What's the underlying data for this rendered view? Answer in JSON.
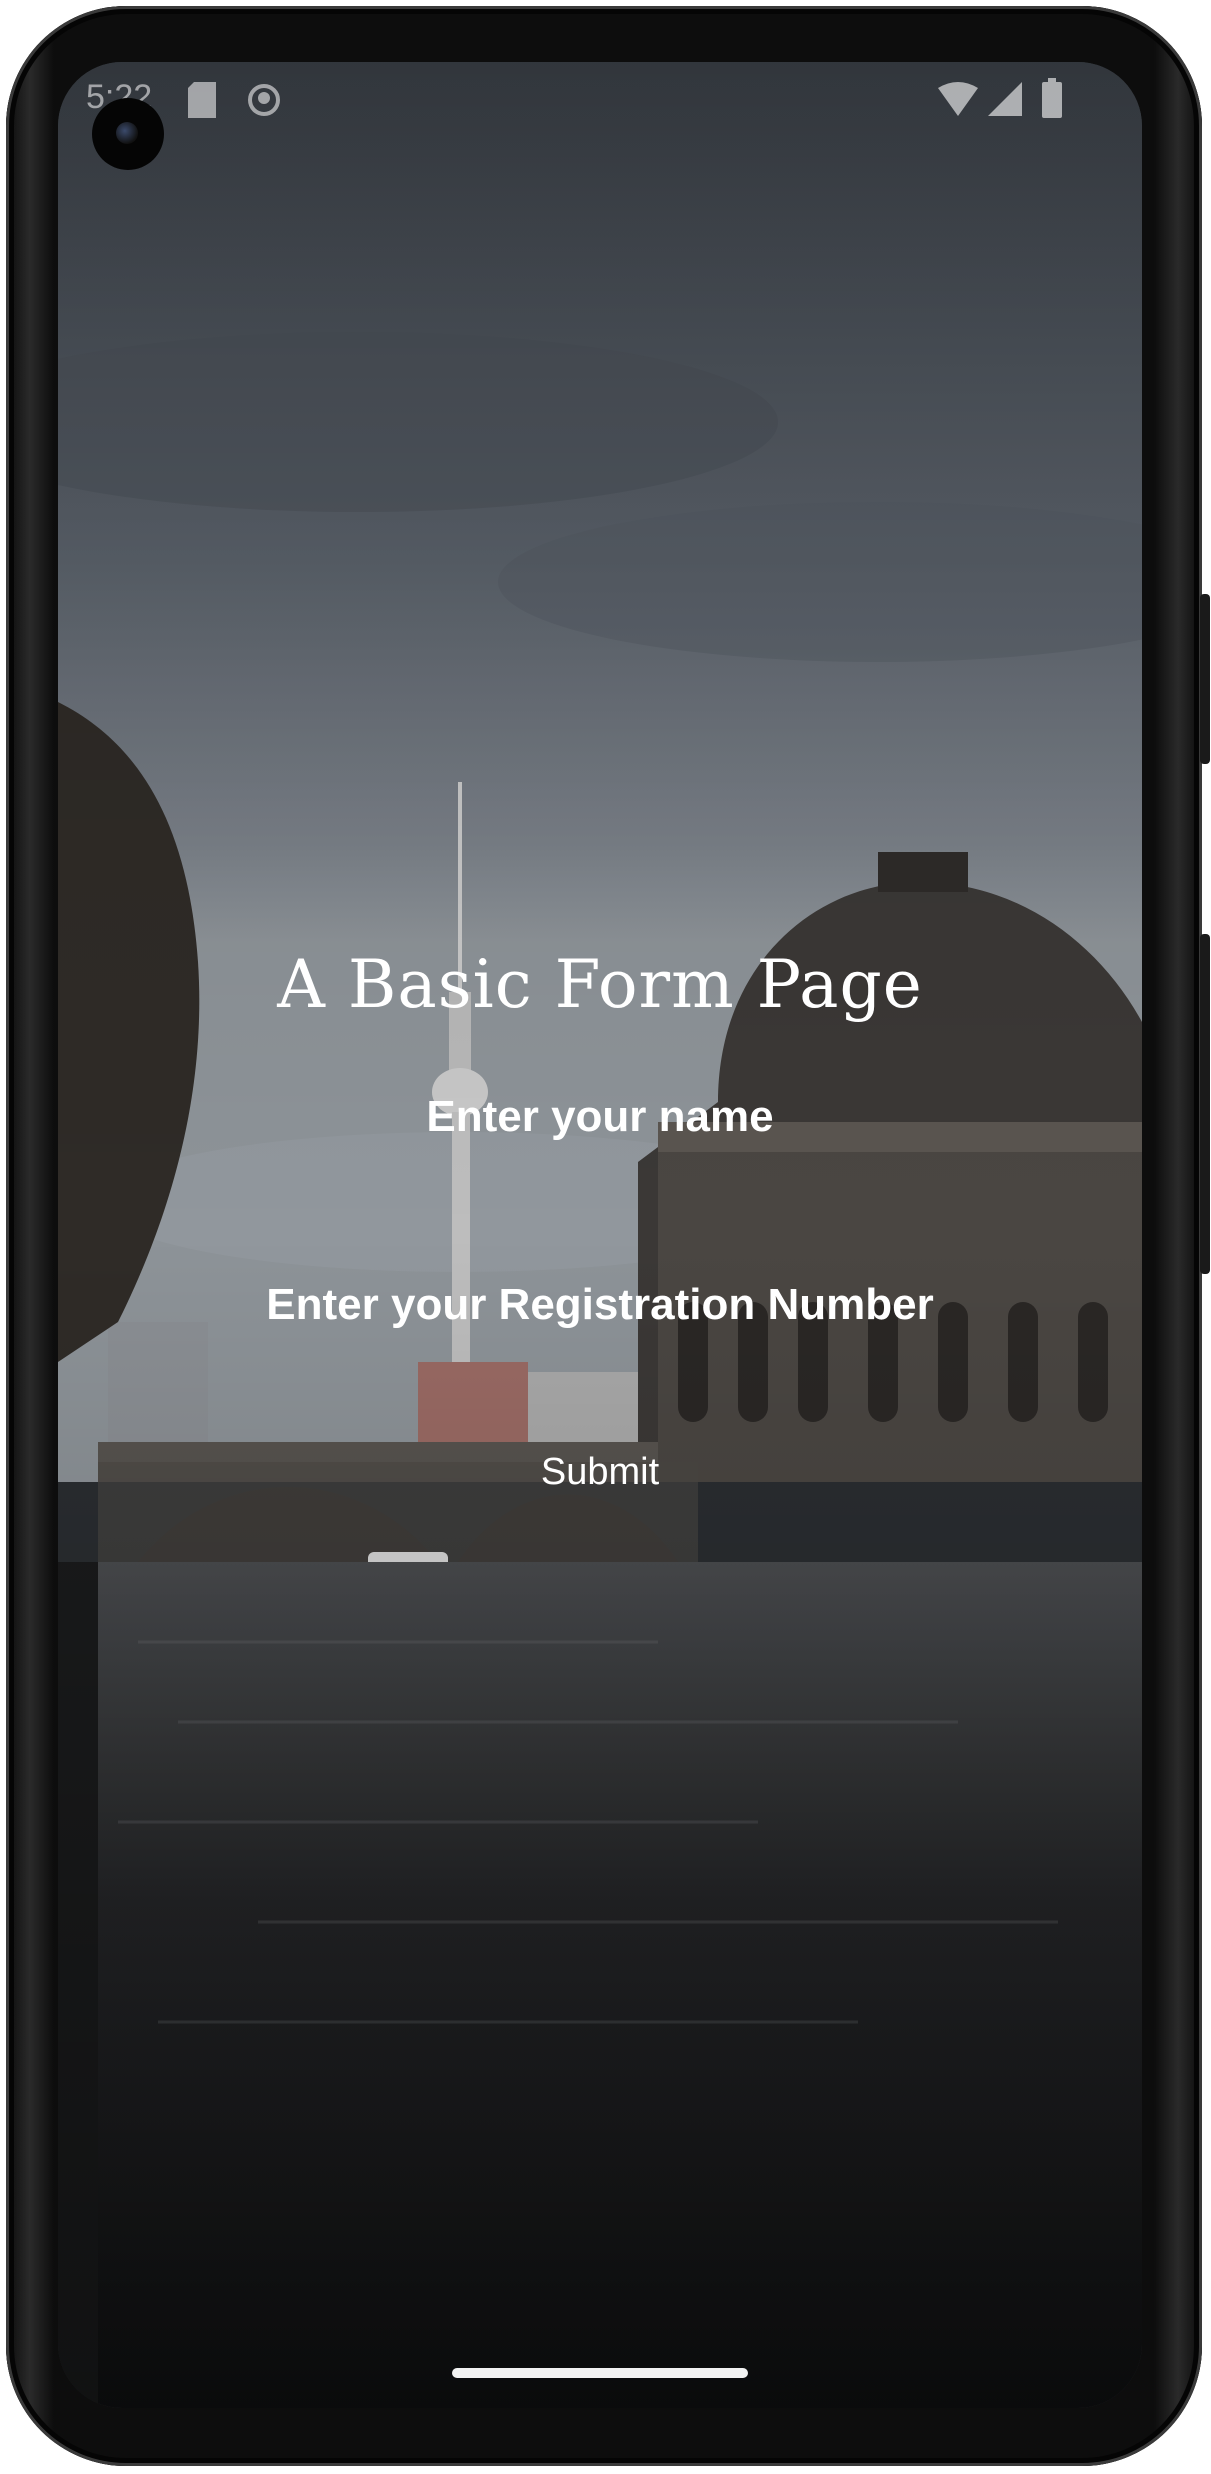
{
  "status_bar": {
    "time": "5:22",
    "left_icons": [
      "sd-card-icon",
      "media-icon"
    ],
    "right_icons": [
      "wifi-icon",
      "cell-signal-icon",
      "battery-icon"
    ]
  },
  "form": {
    "title": "A Basic Form Page",
    "name_label": "Enter your name",
    "registration_label": "Enter your Registration Number",
    "submit_label": "Submit"
  },
  "background": {
    "description_icon": "city-river-photo"
  }
}
